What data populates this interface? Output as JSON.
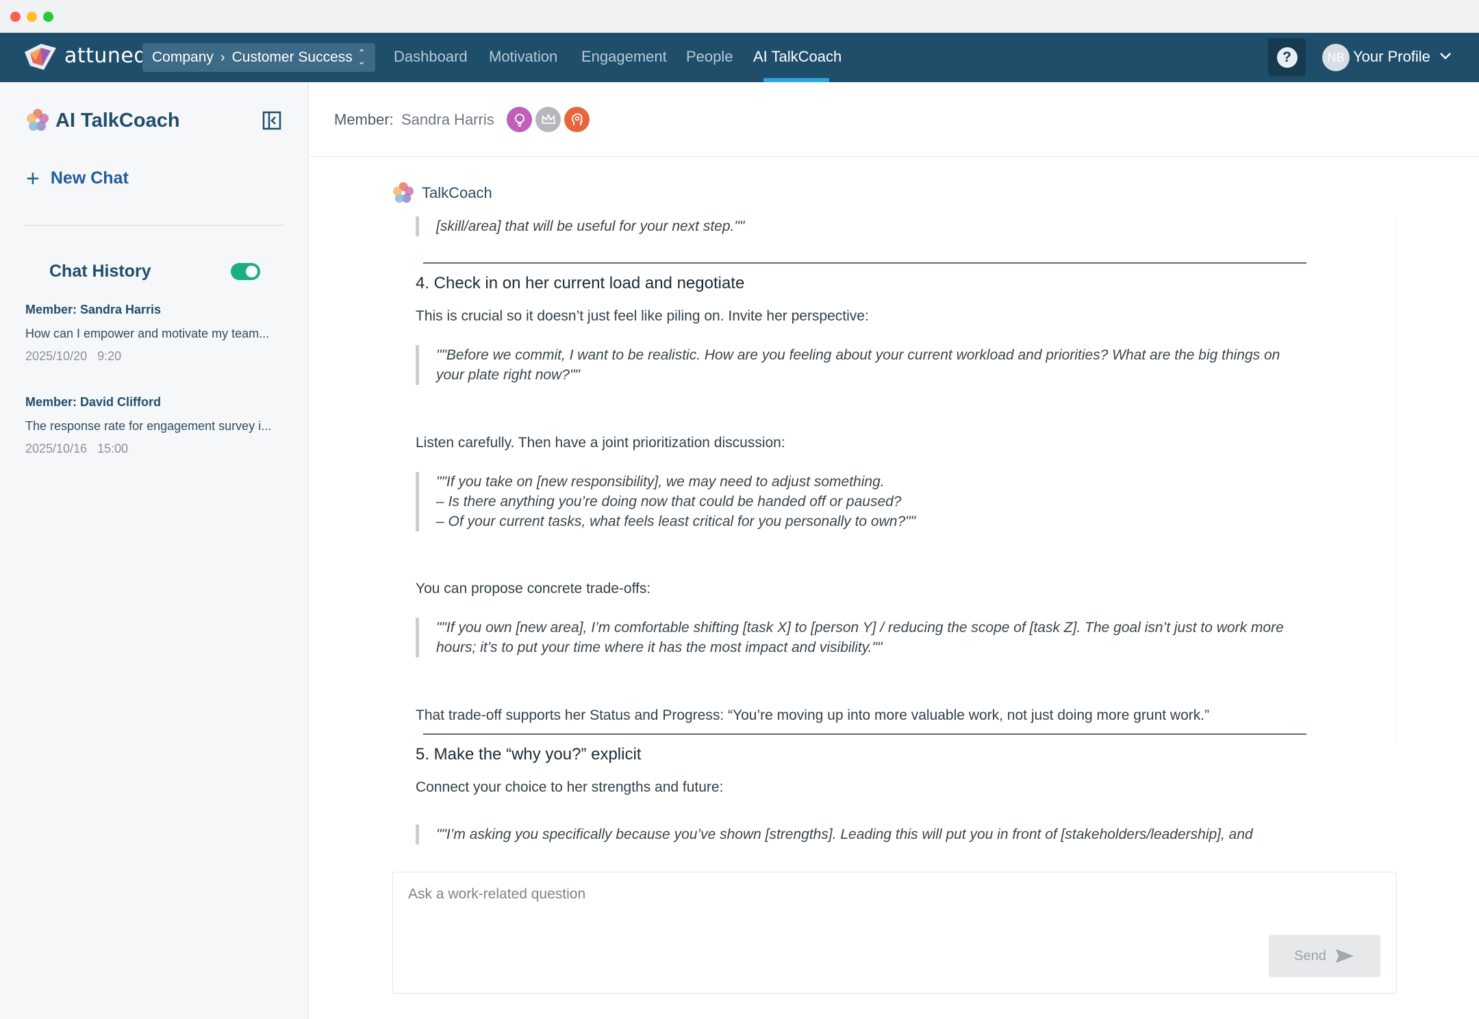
{
  "nav": {
    "brand": "attuned",
    "company": "Company",
    "team": "Customer Success",
    "links": [
      "Dashboard",
      "Motivation",
      "Engagement",
      "People",
      "AI TalkCoach"
    ],
    "active_link": "AI TalkCoach",
    "help": "?",
    "avatar_initials": "NB",
    "profile_label": "Your Profile"
  },
  "sidebar": {
    "title": "AI TalkCoach",
    "new_chat": "New Chat",
    "history_title": "Chat History",
    "history_toggle_on": true,
    "history": [
      {
        "member": "Member: Sandra Harris",
        "preview": "How can I empower and motivate my team...",
        "date": "2025/10/20   9:20"
      },
      {
        "member": "Member: David Clifford",
        "preview": "The response rate for engagement survey i...",
        "date": "2025/10/16   15:00"
      }
    ]
  },
  "member": {
    "label": "Member:",
    "name": "Sandra Harris"
  },
  "chat": {
    "sender": "TalkCoach",
    "quote0": "[skill/area] that will be useful for your next step.\"\"",
    "h4": "4. Check in on her current load and negotiate",
    "p1": "This is crucial so it doesn’t just feel like piling on. Invite her perspective:",
    "quote1": "\"\"Before we commit, I want to be realistic. How are you feeling about your current workload and priorities? What are the big things on your plate right now?\"\"",
    "p2": "Listen carefully. Then have a joint prioritization discussion:",
    "quote2_l1": "\"\"If you take on [new responsibility], we may need to adjust something.",
    "quote2_l2": "– Is there anything you’re doing now that could be handed off or paused?",
    "quote2_l3": "– Of your current tasks, what feels least critical for you personally to own?\"\"",
    "p3": "You can propose concrete trade-offs:",
    "quote3": "\"\"If you own [new area], I’m comfortable shifting [task X] to [person Y] / reducing the scope of [task Z]. The goal isn’t just to work more hours; it’s to put your time where it has the most impact and visibility.\"\"",
    "p4": "That trade-off supports her Status and Progress: “You’re moving up into more valuable work, not just doing more grunt work.”",
    "h5": "5. Make the “why you?” explicit",
    "p5": "Connect your choice to her strengths and future:",
    "quote4": "\"\"I’m asking you specifically because you’ve shown [strengths]. Leading this will put you in front of [stakeholders/leadership], and"
  },
  "composer": {
    "placeholder": "Ask a work-related question",
    "send": "Send"
  },
  "colors": {
    "nav_bg": "#1f4e6b",
    "accent": "#2ba6e0",
    "toggle_on": "#1cae82",
    "title": "#1f4e6b"
  }
}
